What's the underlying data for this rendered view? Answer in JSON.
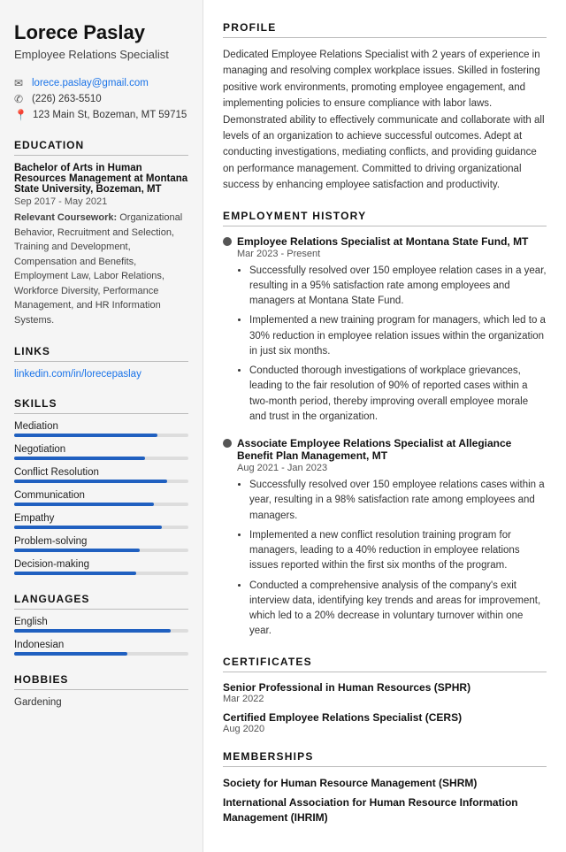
{
  "sidebar": {
    "name": "Lorece Paslay",
    "job_title": "Employee Relations Specialist",
    "contact": {
      "email": "lorece.paslay@gmail.com",
      "phone": "(226) 263-5510",
      "address": "123 Main St, Bozeman, MT 59715"
    },
    "education_section_title": "EDUCATION",
    "education": {
      "degree": "Bachelor of Arts in Human Resources Management at Montana State University, Bozeman, MT",
      "dates": "Sep 2017 - May 2021",
      "coursework_label": "Relevant Coursework:",
      "coursework": "Organizational Behavior, Recruitment and Selection, Training and Development, Compensation and Benefits, Employment Law, Labor Relations, Workforce Diversity, Performance Management, and HR Information Systems."
    },
    "links_section_title": "LINKS",
    "links": [
      {
        "label": "linkedin.com/in/lorecepaslay",
        "url": "#"
      }
    ],
    "skills_section_title": "SKILLS",
    "skills": [
      {
        "label": "Mediation",
        "pct": 82
      },
      {
        "label": "Negotiation",
        "pct": 75
      },
      {
        "label": "Conflict Resolution",
        "pct": 88
      },
      {
        "label": "Communication",
        "pct": 80
      },
      {
        "label": "Empathy",
        "pct": 85
      },
      {
        "label": "Problem-solving",
        "pct": 72
      },
      {
        "label": "Decision-making",
        "pct": 70
      }
    ],
    "languages_section_title": "LANGUAGES",
    "languages": [
      {
        "label": "English",
        "pct": 90
      },
      {
        "label": "Indonesian",
        "pct": 65
      }
    ],
    "hobbies_section_title": "HOBBIES",
    "hobbies": [
      "Gardening"
    ]
  },
  "main": {
    "profile_section_title": "PROFILE",
    "profile_text": "Dedicated Employee Relations Specialist with 2 years of experience in managing and resolving complex workplace issues. Skilled in fostering positive work environments, promoting employee engagement, and implementing policies to ensure compliance with labor laws. Demonstrated ability to effectively communicate and collaborate with all levels of an organization to achieve successful outcomes. Adept at conducting investigations, mediating conflicts, and providing guidance on performance management. Committed to driving organizational success by enhancing employee satisfaction and productivity.",
    "employment_section_title": "EMPLOYMENT HISTORY",
    "jobs": [
      {
        "title": "Employee Relations Specialist at Montana State Fund, MT",
        "dates": "Mar 2023 - Present",
        "bullets": [
          "Successfully resolved over 150 employee relation cases in a year, resulting in a 95% satisfaction rate among employees and managers at Montana State Fund.",
          "Implemented a new training program for managers, which led to a 30% reduction in employee relation issues within the organization in just six months.",
          "Conducted thorough investigations of workplace grievances, leading to the fair resolution of 90% of reported cases within a two-month period, thereby improving overall employee morale and trust in the organization."
        ]
      },
      {
        "title": "Associate Employee Relations Specialist at Allegiance Benefit Plan Management, MT",
        "dates": "Aug 2021 - Jan 2023",
        "bullets": [
          "Successfully resolved over 150 employee relations cases within a year, resulting in a 98% satisfaction rate among employees and managers.",
          "Implemented a new conflict resolution training program for managers, leading to a 40% reduction in employee relations issues reported within the first six months of the program.",
          "Conducted a comprehensive analysis of the company's exit interview data, identifying key trends and areas for improvement, which led to a 20% decrease in voluntary turnover within one year."
        ]
      }
    ],
    "certificates_section_title": "CERTIFICATES",
    "certificates": [
      {
        "name": "Senior Professional in Human Resources (SPHR)",
        "date": "Mar 2022"
      },
      {
        "name": "Certified Employee Relations Specialist (CERS)",
        "date": "Aug 2020"
      }
    ],
    "memberships_section_title": "MEMBERSHIPS",
    "memberships": [
      "Society for Human Resource Management (SHRM)",
      "International Association for Human Resource Information Management (IHRIM)"
    ]
  }
}
